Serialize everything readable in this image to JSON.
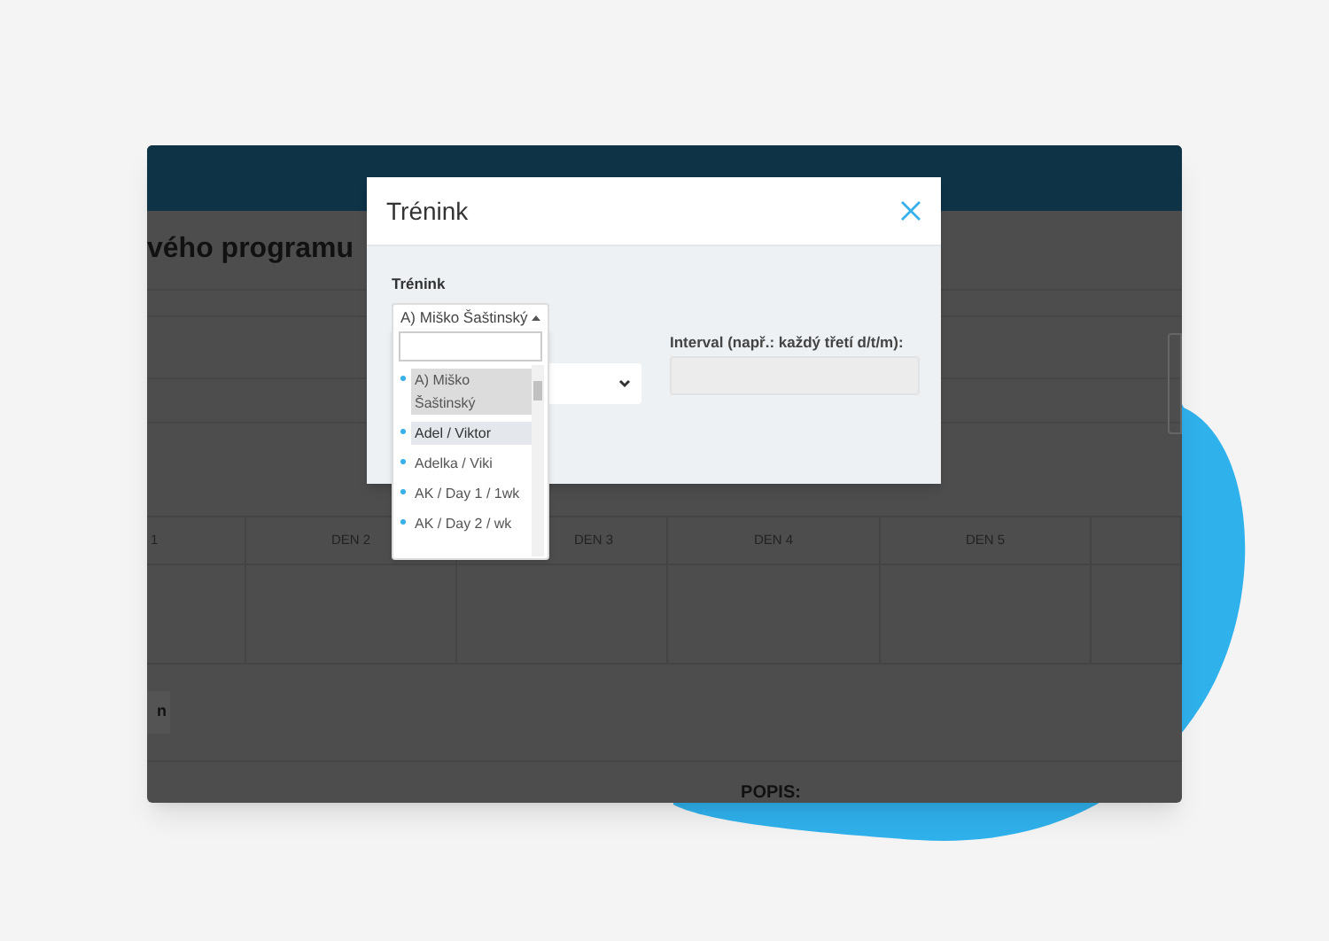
{
  "background": {
    "heading": "vého programu",
    "day_columns": [
      "1",
      "DEN 2",
      "DEN 3",
      "DEN 4",
      "DEN 5"
    ],
    "button_fragment": "n",
    "description_label": "POPIS:"
  },
  "modal": {
    "title": "Trénink",
    "training_select": {
      "label": "Trénink",
      "value": "A) Miško Šaštinský",
      "expanded": true,
      "options": [
        {
          "label": "A) Miško Šaštinský",
          "selected": true,
          "hovered": false
        },
        {
          "label": "Adel / Viktor",
          "selected": false,
          "hovered": true
        },
        {
          "label": "Adelka / Viki",
          "selected": false,
          "hovered": false
        },
        {
          "label": "AK / Day 1 / 1wk",
          "selected": false,
          "hovered": false
        },
        {
          "label": "AK / Day 2 / wk",
          "selected": false,
          "hovered": false
        }
      ]
    },
    "interval": {
      "label": "Interval (např.: každý třetí d/t/m):",
      "disabled": true
    }
  }
}
